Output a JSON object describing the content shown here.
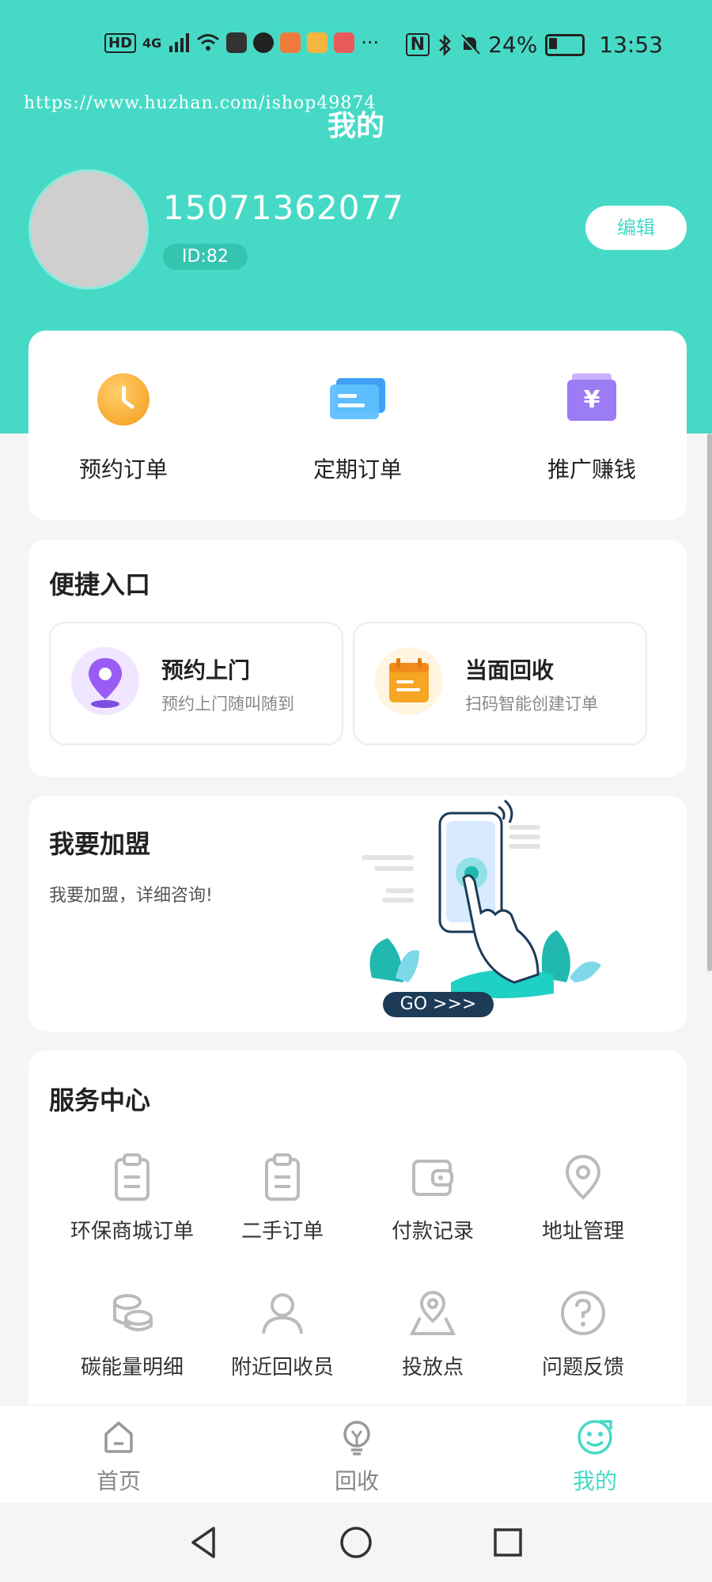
{
  "status_bar": {
    "left_text": "HD",
    "network": "4G",
    "dots": "···",
    "battery": "24%",
    "time": "13:53"
  },
  "watermark": "https://www.huzhan.com/ishop49874",
  "page": {
    "title": "我的"
  },
  "profile": {
    "phone": "15071362077",
    "id_label": "ID:82",
    "edit_label": "编辑"
  },
  "orders": [
    {
      "label": "预约订单",
      "icon": "clock-icon"
    },
    {
      "label": "定期订单",
      "icon": "cards-icon"
    },
    {
      "label": "推广赚钱",
      "icon": "money-icon",
      "symbol": "¥"
    }
  ],
  "quick": {
    "title": "便捷入口",
    "tiles": [
      {
        "title": "预约上门",
        "subtitle": "预约上门随叫随到",
        "icon": "location-pin-icon"
      },
      {
        "title": "当面回收",
        "subtitle": "扫码智能创建订单",
        "icon": "calendar-icon"
      }
    ]
  },
  "join": {
    "title": "我要加盟",
    "subtitle": "我要加盟，详细咨询!",
    "go_label": "GO  >>>"
  },
  "services": {
    "title": "服务中心",
    "items": [
      {
        "label": "环保商城订单",
        "icon": "clipboard-icon"
      },
      {
        "label": "二手订单",
        "icon": "clipboard-icon"
      },
      {
        "label": "付款记录",
        "icon": "wallet-icon"
      },
      {
        "label": "地址管理",
        "icon": "location-icon"
      },
      {
        "label": "碳能量明细",
        "icon": "coins-icon"
      },
      {
        "label": "附近回收员",
        "icon": "user-icon"
      },
      {
        "label": "投放点",
        "icon": "map-pin-icon"
      },
      {
        "label": "问题反馈",
        "icon": "question-icon"
      }
    ]
  },
  "tabs": [
    {
      "label": "首页",
      "icon": "home-icon",
      "active": false
    },
    {
      "label": "回收",
      "icon": "recycle-bulb-icon",
      "active": false
    },
    {
      "label": "我的",
      "icon": "smile-face-icon",
      "active": true
    }
  ],
  "colors": {
    "accent": "#46dac6",
    "accent_dark": "#36c4b1",
    "orange": "#f59a1b",
    "blue": "#3fa0f5",
    "purple": "#9b7cf5",
    "navy": "#1d3a57"
  }
}
